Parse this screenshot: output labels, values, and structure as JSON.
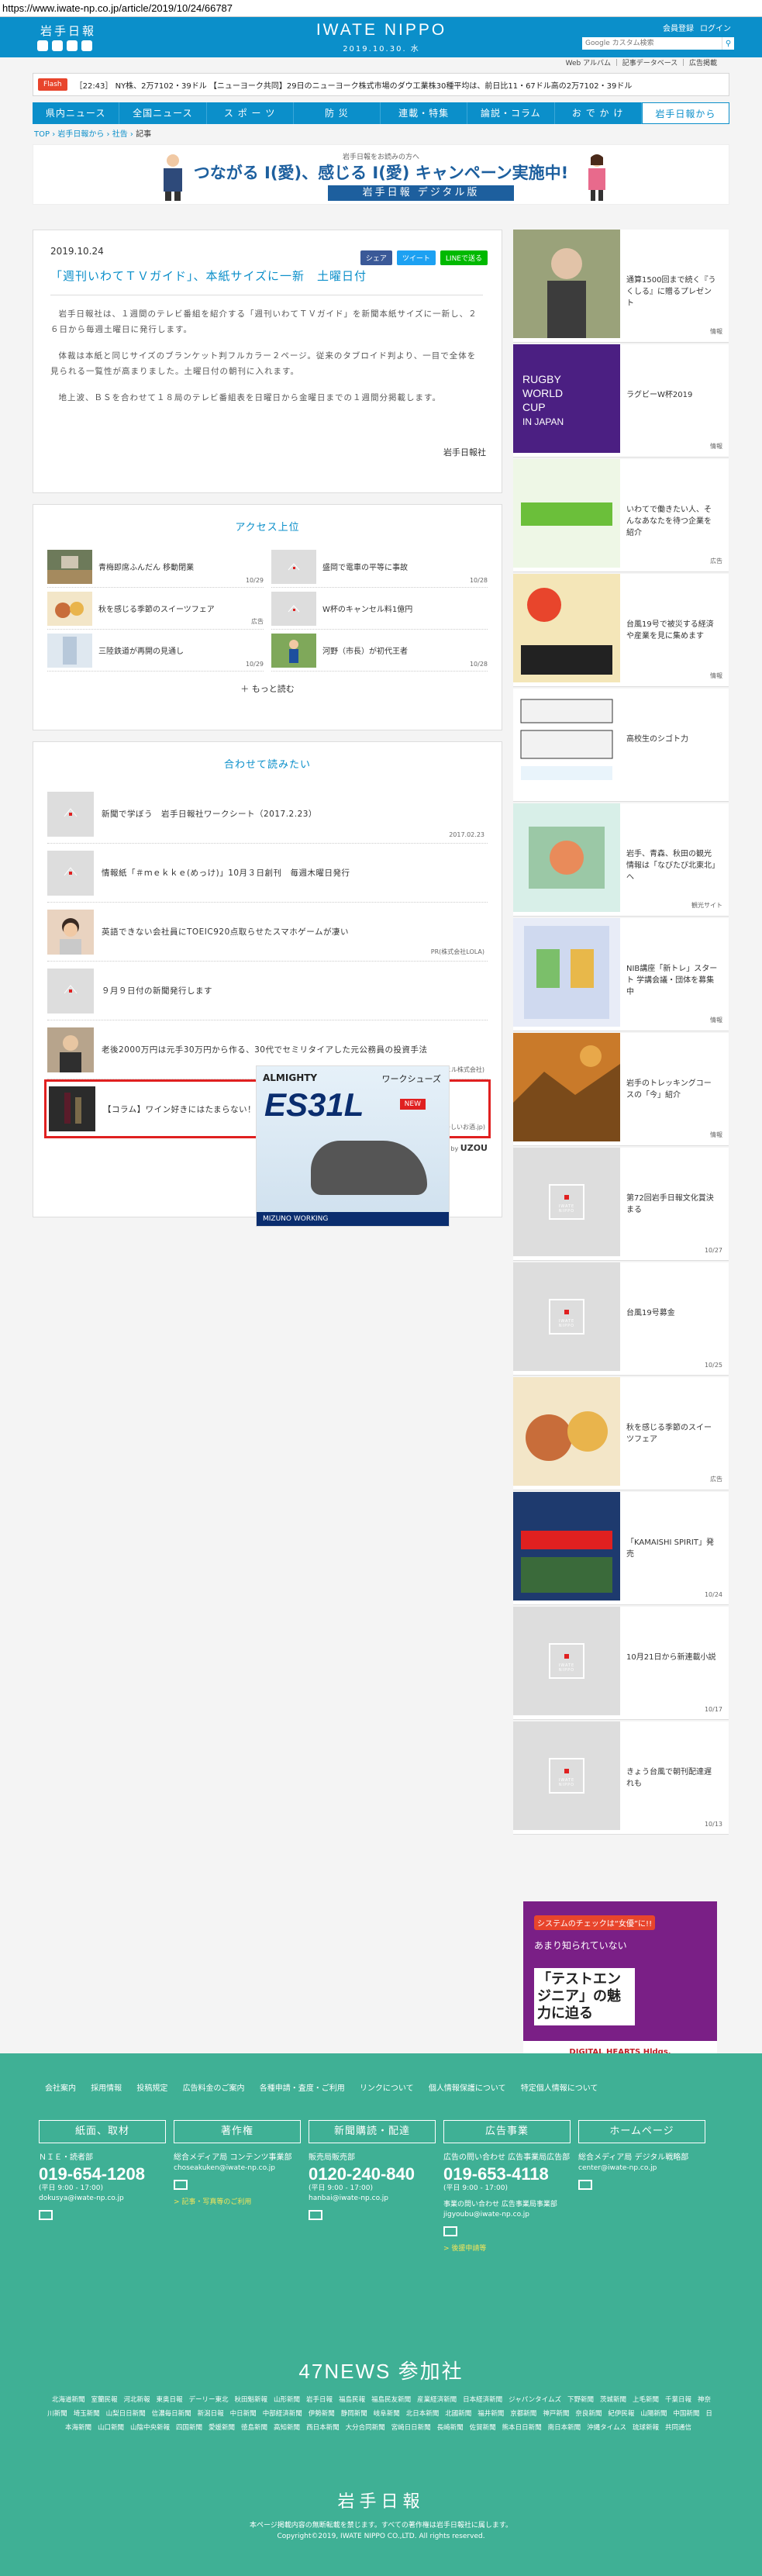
{
  "url": "https://www.iwate-np.co.jp/article/2019/10/24/66787",
  "header": {
    "logo_jp": "岩手日報",
    "logo_en": "IWATE NIPPO",
    "date": "2019.10.30. 水",
    "links": [
      "会員登録",
      "ログイン"
    ],
    "search_placeholder": "Google カスタム検索",
    "sublinks": "Web アルバム ｜ 記事データベース ｜ 広告掲載"
  },
  "ticker": {
    "label": "Flash",
    "text": "［22:43］ NY株、2万7102・39ドル 【ニューヨーク共同】29日のニューヨーク株式市場のダウ工業株30種平均は、前日比11・67ドル高の2万7102・39ドル"
  },
  "nav": [
    "県内ニュース",
    "全国ニュース",
    "ス ポ ー ツ",
    "防 災",
    "連載・特集",
    "論説・コラム",
    "お で か け",
    "岩手日報から"
  ],
  "breadcrumb": [
    "TOP",
    "岩手日報から",
    "社告",
    "記事"
  ],
  "banner": {
    "small": "岩手日報をお読みの方へ",
    "big": "つながる I(愛)、感じる I(愛) キャンペーン実施中!",
    "brand": "岩手日報 デジタル版"
  },
  "article": {
    "date": "2019.10.24",
    "share": [
      "シェア",
      "ツイート",
      "LINEで送る"
    ],
    "title": "「週刊いわてＴＶガイド」、本紙サイズに一新　土曜日付",
    "paragraphs": [
      "岩手日報社は、１週間のテレビ番組を紹介する「週刊いわてＴＶガイド」を新聞本紙サイズに一新し、２６日から毎週土曜日に発行します。",
      "体裁は本紙と同じサイズのブランケット判フルカラー２ページ。従来のタブロイド判より、一目で全体を見られる一覧性が高まりました。土曜日付の朝刊に入れます。",
      "地上波、ＢＳを合わせて１８局のテレビ番組表を日曜日から金曜日までの１週間分掲載します。"
    ],
    "author": "岩手日報社"
  },
  "ranking": {
    "title": "アクセス上位",
    "items": [
      {
        "t": "青梅即席ふんだん 移動閉業",
        "d": "10/29"
      },
      {
        "t": "盛岡で電車の平等に事故",
        "d": "10/28"
      },
      {
        "t": "秋を感じる季節のスイーツフェア",
        "d": "広告"
      },
      {
        "t": "W杯のキャンセル料1億円",
        "d": ""
      },
      {
        "t": "三陸鉄道が再開の見通し",
        "d": "10/29"
      },
      {
        "t": "河野（市長）が初代王者",
        "d": "10/28"
      }
    ],
    "more": "もっと読む"
  },
  "related": {
    "title": "合わせて読みたい",
    "items": [
      {
        "t": "新聞で学ぼう　岩手日報社ワークシート（2017.2.23）",
        "d": "2017.02.23"
      },
      {
        "t": "情報紙「＃ｍｅｋｋｅ(めっけ)」10月３日創刊　毎週木曜日発行",
        "d": ""
      },
      {
        "t": "英語できない会社員にTOEIC920点取らせたスマホゲームが凄い",
        "d": "PR(株式会社LOLA)"
      },
      {
        "t": "９月９日付の新聞発行します",
        "d": ""
      },
      {
        "t": "老後2000万円は元手30万円から作る、30代でセミリタイアした元公務員の投資手法",
        "d": "PR(アップヒル株式会社)"
      },
      {
        "t": "【コラム】ワイン好きにはたまらない！ワインの三和論一覧",
        "d": "PR(たのしいお酒.jp)"
      }
    ],
    "powered": "Recommended by",
    "brand": "UZOU"
  },
  "ad_shoe": {
    "brand": "ALMIGHTY",
    "jp": "ワークシューズ",
    "model": "ES31L",
    "new": "NEW",
    "foot": "MIZUNO WORKING"
  },
  "sidebar": [
    {
      "t": "通算1500回まで続く『うくしる』に贈るプレゼント",
      "d": "情報"
    },
    {
      "t": "ラグビーW杯2019",
      "d": "情報"
    },
    {
      "t": "いわてで働きたい人、そんなあなたを待つ企業を紹介",
      "d": "広告"
    },
    {
      "t": "台風19号で被災する経済や産業を見に集めます",
      "d": "情報"
    },
    {
      "t": "高校生のシゴト力",
      "d": ""
    },
    {
      "t": "岩手、青森、秋田の観光情報は「なびたび北東北」へ",
      "d": "観光サイト"
    },
    {
      "t": "NIB講座「新トレ」スタート  学講会議・団体を募集中",
      "d": "情報"
    },
    {
      "t": "岩手のトレッキングコースの「今」紹介",
      "d": "情報"
    },
    {
      "t": "第72回岩手日報文化賞決まる",
      "d": "10/27"
    },
    {
      "t": "台風19号募金",
      "d": "10/25"
    },
    {
      "t": "秋を感じる季節のスイーツフェア",
      "d": "広告"
    },
    {
      "t": "「KAMAISHI SPIRIT」発売",
      "d": "10/24"
    },
    {
      "t": "10月21日から新連載小説",
      "d": "10/17"
    },
    {
      "t": "きょう台風で朝刊配達遅れも",
      "d": "10/13"
    }
  ],
  "side_ad": {
    "a": "システムのチェックは“女優”に!!",
    "b": "あまり知られていない",
    "c": "「テストエンジニア」の魅力に迫る",
    "e": "DIGITAL HEARTS Hldgs."
  },
  "footer": {
    "links": [
      "会社案内",
      "採用情報",
      "投稿規定",
      "広告料金のご案内",
      "各種申請・査度・ご利用",
      "リンクについて",
      "個人情報保護について",
      "特定個人情報について"
    ],
    "cols": [
      {
        "hd": "紙面、取材",
        "l": "ＮＩＥ・読者部",
        "tel": "019-654-1208",
        "s": "(平日 9:00 - 17:00)",
        "m": "dokusya@iwate-np.co.jp",
        "y": ""
      },
      {
        "hd": "著作権",
        "l": "総合メディア局 コンテンツ事業部",
        "tel": "",
        "s": "choseakuken@iwate-np.co.jp",
        "m": "",
        "y": "> 記事・写真等のご利用"
      },
      {
        "hd": "新聞購読・配達",
        "l": "販売局販売部",
        "tel": "0120-240-840",
        "s": "(平日 9:00 - 17:00)",
        "m": "hanbai@iwate-np.co.jp",
        "y": ""
      },
      {
        "hd": "広告事業",
        "l": "広告の問い合わせ 広告事業局広告部",
        "tel": "019-653-4118",
        "s": "(平日 9:00 - 17:00)",
        "m": "事業の問い合わせ 広告事業局事業部 jigyoubu@iwate-np.co.jp",
        "y": "> 後援申請等"
      },
      {
        "hd": "ホームページ",
        "l": "総合メディア局 デジタル戦略部",
        "tel": "",
        "s": "center@iwate-np.co.jp",
        "m": "",
        "y": ""
      }
    ],
    "title47": "47NEWS 参加社",
    "list47": [
      "北海道新聞",
      "室蘭民報",
      "河北新報",
      "東奥日報",
      "デーリー東北",
      "秋田魁新報",
      "山形新聞",
      "岩手日報",
      "福島民報",
      "福島民友新聞",
      "産業経済新聞",
      "日本経済新聞",
      "ジャパンタイムズ",
      "下野新聞",
      "茨城新聞",
      "上毛新聞",
      "千葉日報",
      "神奈川新聞",
      "埼玉新聞",
      "山梨日日新聞",
      "信濃毎日新聞",
      "新潟日報",
      "中日新聞",
      "中部経済新聞",
      "伊勢新聞",
      "静岡新聞",
      "岐阜新聞",
      "北日本新聞",
      "北國新聞",
      "福井新聞",
      "京都新聞",
      "神戸新聞",
      "奈良新聞",
      "紀伊民報",
      "山陽新聞",
      "中国新聞",
      "日本海新聞",
      "山口新聞",
      "山陰中央新報",
      "四国新聞",
      "愛媛新聞",
      "徳島新聞",
      "高知新聞",
      "西日本新聞",
      "大分合同新聞",
      "宮崎日日新聞",
      "長崎新聞",
      "佐賀新聞",
      "熊本日日新聞",
      "南日本新聞",
      "沖縄タイムス",
      "琉球新報",
      "共同通信"
    ],
    "logo": "岩手日報",
    "copy1": "本ページ掲載内容の無断転載を禁じます。すべての著作権は岩手日報社に属します。",
    "copy2": "Copyright©2019, IWATE NIPPO CO.,LTD. All rights reserved."
  },
  "colors": {
    "brand": "#0b8fca",
    "footer": "#3fb095",
    "highlight": "#e02020"
  }
}
